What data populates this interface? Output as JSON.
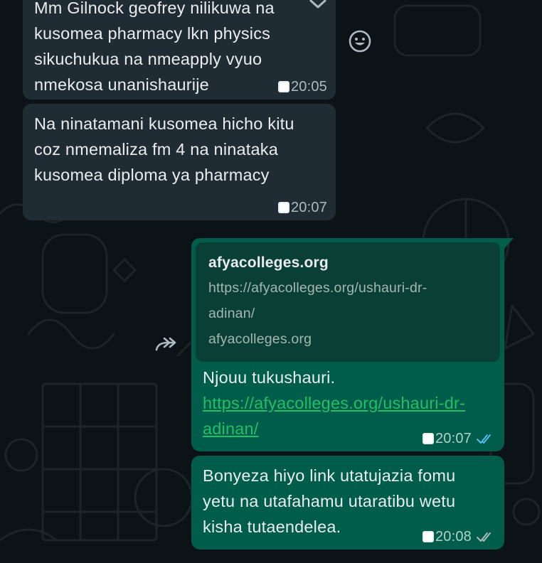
{
  "messages": [
    {
      "id": "m1",
      "lines": [
        "Mm Gilnock geofrey nilikuwa na",
        "kusomea pharmacy lkn physics",
        "sikuchukua na nmeapply vyuo",
        "nmekosa unanishaurije"
      ],
      "time": "20:05"
    },
    {
      "id": "m2",
      "lines": [
        "Na ninatamani kusomea hicho kitu",
        "coz nmemaliza fm 4 na ninataka",
        "kusomea diploma ya pharmacy"
      ],
      "time": "20:07"
    },
    {
      "id": "m3",
      "preview": {
        "title": "afyacolleges.org",
        "url_lines": [
          "https://afyacolleges.org/ushauri-dr-",
          "adinan/"
        ],
        "domain": "afyacolleges.org"
      },
      "text": "Njouu tukushauri.",
      "link_lines": [
        "https://afyacolleges.org/ushauri-dr-",
        "adinan/"
      ],
      "time": "20:07",
      "read_color": "#53bdeb"
    },
    {
      "id": "m4",
      "lines": [
        "Bonyeza hiyo link utatujazia fomu",
        "yetu na utafahamu utaratibu wetu",
        "kisha tutaendelea."
      ],
      "time": "20:08",
      "read_color": "#aebac1"
    }
  ],
  "icons": {
    "chevron": "chevron-down-icon",
    "emoji": "emoji-icon",
    "forward": "forward-icon"
  }
}
